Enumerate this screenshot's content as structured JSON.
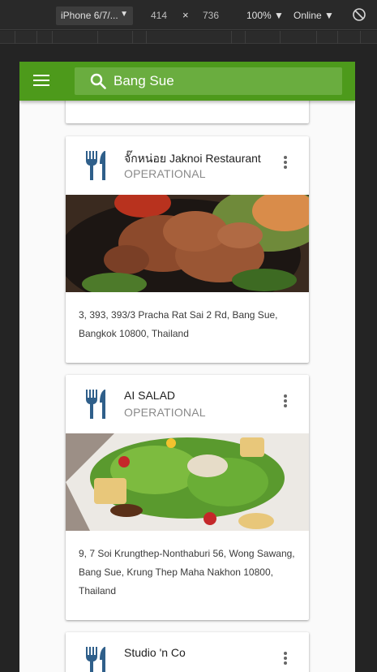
{
  "devtools": {
    "device": "iPhone 6/7/...",
    "width": "414",
    "times": "×",
    "height": "736",
    "zoom": "100%",
    "network": "Online",
    "caret": "▼",
    "rotate_icon": "rotate-icon"
  },
  "app": {
    "menu_icon": "hamburger-menu-icon",
    "search_icon": "search-icon",
    "search_value": "Bang Sue",
    "accent": "#4d9a1b"
  },
  "places": [
    {
      "name": "จั๊กหน่อย Jaknoi Restaurant",
      "status": "OPERATIONAL",
      "address": "3, 393, 393/3 Pracha Rat Sai 2 Rd, Bang Sue, Bangkok 10800, Thailand",
      "icon": "restaurant-icon",
      "photo": "grilled-pork-photo"
    },
    {
      "name": "AI SALAD",
      "status": "OPERATIONAL",
      "address": "9, 7 Soi Krungthep-Nonthaburi 56, Wong Sawang, Bang Sue, Krung Thep Maha Nakhon 10800, Thailand",
      "icon": "restaurant-icon",
      "photo": "salad-photo"
    },
    {
      "name": "Studio 'n Co",
      "status": "",
      "address": "",
      "icon": "restaurant-icon",
      "photo": ""
    }
  ]
}
